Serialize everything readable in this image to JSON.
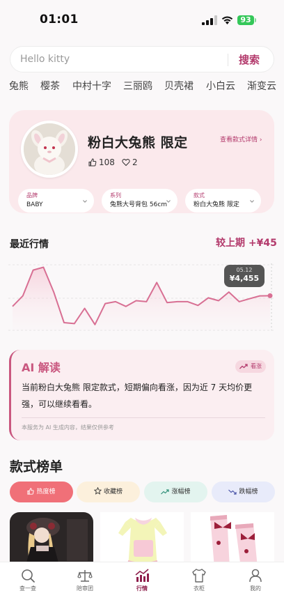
{
  "status": {
    "time": "01:01",
    "battery": "93"
  },
  "search": {
    "placeholder": "Hello kitty",
    "button_label": "搜索"
  },
  "tags": [
    "兔熊",
    "樱茶",
    "中村十字",
    "三丽鸥",
    "贝壳裙",
    "小白云",
    "渐变云"
  ],
  "product": {
    "title": "粉白大兔熊 限定",
    "detail_link": "查看款式详情 ›",
    "likes": "108",
    "favorites": "2",
    "filters": [
      {
        "label": "品牌",
        "value": "BABY"
      },
      {
        "label": "系列",
        "value": "兔熊大号背包 56cm"
      },
      {
        "label": "款式",
        "value": "粉白大兔熊 限定"
      }
    ]
  },
  "market": {
    "title": "最近行情",
    "compare": "较上期 +¥45",
    "tooltip_date": "05.12",
    "tooltip_value": "¥4,455"
  },
  "chart_data": {
    "type": "area",
    "title": "",
    "xlabel": "",
    "ylabel": "",
    "values": [
      4150,
      4260,
      4530,
      4560,
      4300,
      3980,
      3970,
      4130,
      3960,
      4180,
      4200,
      4150,
      4210,
      4200,
      4400,
      4190,
      4200,
      4200,
      4160,
      4240,
      4210,
      4300,
      4200,
      4230,
      4260,
      4262
    ],
    "highlight_label": "05.12",
    "color": "#d86f93"
  },
  "ai": {
    "title": "AI 解读",
    "badge": "看涨",
    "body": "当前粉白大兔熊 限定款式，短期偏向看涨，因为近 7 天均价更强，可以继续看看。",
    "note": "本服务为 AI 生成内容，结果仅供参考"
  },
  "ranking": {
    "title": "款式榜单",
    "tabs": [
      {
        "label": "热度榜",
        "bg": "#f07078",
        "color": "#ffffff"
      },
      {
        "label": "收藏榜",
        "bg": "#fcf0dc",
        "color": "#333333"
      },
      {
        "label": "涨幅榜",
        "bg": "#e3f4ef",
        "color": "#333333"
      },
      {
        "label": "跌幅榜",
        "bg": "#e8ebfa",
        "color": "#333333"
      }
    ]
  },
  "tabbar": {
    "items": [
      {
        "label": "查一查"
      },
      {
        "label": "陪审团"
      },
      {
        "label": "行情"
      },
      {
        "label": "衣柜"
      },
      {
        "label": "我的"
      }
    ],
    "active": 2
  }
}
